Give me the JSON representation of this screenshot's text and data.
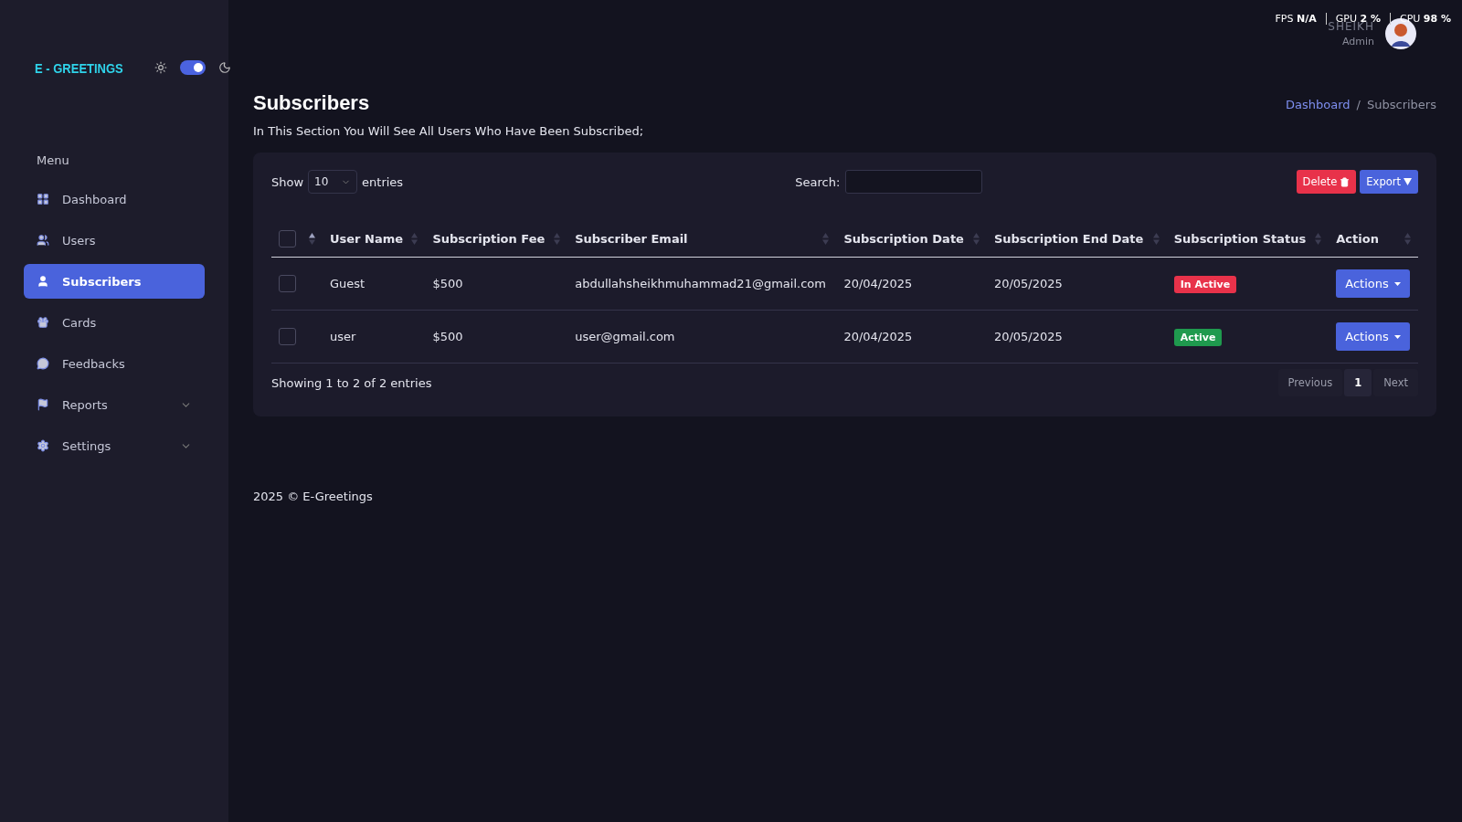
{
  "overlay": {
    "items": [
      {
        "label": "FPS",
        "value": "N/A"
      },
      {
        "label": "GPU",
        "value": "2 %"
      },
      {
        "label": "CPU",
        "value": "98 %"
      }
    ]
  },
  "user": {
    "name": "SHEIKH",
    "role": "Admin"
  },
  "sidebar": {
    "logo": "E - GREETINGS",
    "theme_toggle": {
      "on": true
    },
    "menu_title": "Menu",
    "items": [
      {
        "label": "Dashboard",
        "selected": false
      },
      {
        "label": "Users",
        "selected": false
      },
      {
        "label": "Subscribers",
        "selected": true
      },
      {
        "label": "Cards",
        "selected": false
      },
      {
        "label": "Feedbacks",
        "selected": false
      },
      {
        "label": "Reports",
        "selected": false,
        "expanded": false
      },
      {
        "label": "Settings",
        "selected": false,
        "expanded": false
      }
    ]
  },
  "page": {
    "title": "Subscribers",
    "subtitle": "In This Section You Will See All Users Who Have Been Subscribed;",
    "breadcrumb": [
      {
        "label": "Dashboard",
        "selected": false
      },
      {
        "label": "Subscribers",
        "selected": true
      }
    ],
    "breadcrumb_separator": "/"
  },
  "table": {
    "show_label": "Show",
    "page_size": "10",
    "entries_label": "entries",
    "search_label": "Search:",
    "buttons": [
      {
        "label": "Delete",
        "kind": "delete"
      },
      {
        "label": "Export",
        "kind": "export"
      }
    ],
    "select_all": {
      "checked": false
    },
    "columns": [
      {
        "label": "User Name"
      },
      {
        "label": "Subscription Fee"
      },
      {
        "label": "Subscriber Email"
      },
      {
        "label": "Subscription Date"
      },
      {
        "label": "Subscription End Date"
      },
      {
        "label": "Subscription Status"
      },
      {
        "label": "Action"
      }
    ],
    "rows": [
      {
        "checked": false,
        "cells": [
          "Guest",
          "$500",
          "abdullahsheikhmuhammad21@gmail.com",
          "20/04/2025",
          "20/05/2025"
        ],
        "status": {
          "label": "In Active",
          "color": "#e8324a"
        },
        "action": "Actions"
      },
      {
        "checked": false,
        "cells": [
          "user",
          "$500",
          "user@gmail.com",
          "20/04/2025",
          "20/05/2025"
        ],
        "status": {
          "label": "Active",
          "color": "#1f9a4e"
        },
        "action": "Actions"
      }
    ],
    "info": "Showing 1 to 2 of 2 entries",
    "pagination": [
      {
        "label": "Previous",
        "selected": false
      },
      {
        "label": "1",
        "selected": true
      },
      {
        "label": "Next",
        "selected": false
      }
    ]
  },
  "footer": "2025 © E-Greetings"
}
